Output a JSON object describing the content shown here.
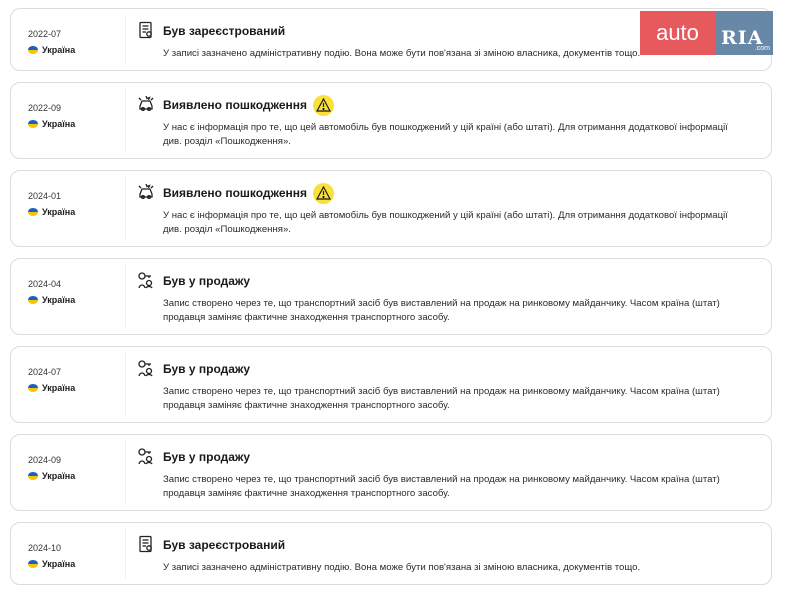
{
  "brand": {
    "auto": "auto",
    "ria": "RIA",
    "domain": ".com"
  },
  "events": [
    {
      "date": "2022-07",
      "country": "Україна",
      "icon": "registration-document-icon",
      "title": "Був зареєстрований",
      "warning": false,
      "description": "У записі зазначено адміністративну подію. Вона може бути пов'язана зі зміною власника, документів тощо."
    },
    {
      "date": "2022-09",
      "country": "Україна",
      "icon": "damaged-car-icon",
      "title": "Виявлено пошкодження",
      "warning": true,
      "description": "У нас є інформація про те, що цей автомобіль був пошкоджений у цій країні (або штаті). Для отримання додаткової інформації див. розділ «Пошкодження»."
    },
    {
      "date": "2024-01",
      "country": "Україна",
      "icon": "damaged-car-icon",
      "title": "Виявлено пошкодження",
      "warning": true,
      "description": "У нас є інформація про те, що цей автомобіль був пошкоджений у цій країні (або штаті). Для отримання додаткової інформації див. розділ «Пошкодження»."
    },
    {
      "date": "2024-04",
      "country": "Україна",
      "icon": "for-sale-key-icon",
      "title": "Був у продажу",
      "warning": false,
      "description": "Запис створено через те, що транспортний засіб був виставлений на продаж на ринковому майданчику. Часом країна (штат) продавця заміняє фактичне знаходження транспортного засобу."
    },
    {
      "date": "2024-07",
      "country": "Україна",
      "icon": "for-sale-key-icon",
      "title": "Був у продажу",
      "warning": false,
      "description": "Запис створено через те, що транспортний засіб був виставлений на продаж на ринковому майданчику. Часом країна (штат) продавця заміняє фактичне знаходження транспортного засобу."
    },
    {
      "date": "2024-09",
      "country": "Україна",
      "icon": "for-sale-key-icon",
      "title": "Був у продажу",
      "warning": false,
      "description": "Запис створено через те, що транспортний засіб був виставлений на продаж на ринковому майданчику. Часом країна (штат) продавця заміняє фактичне знаходження транспортного засобу."
    },
    {
      "date": "2024-10",
      "country": "Україна",
      "icon": "registration-document-icon",
      "title": "Був зареєстрований",
      "warning": false,
      "description": "У записі зазначено адміністративну подію. Вона може бути пов'язана зі зміною власника, документів тощо."
    }
  ]
}
